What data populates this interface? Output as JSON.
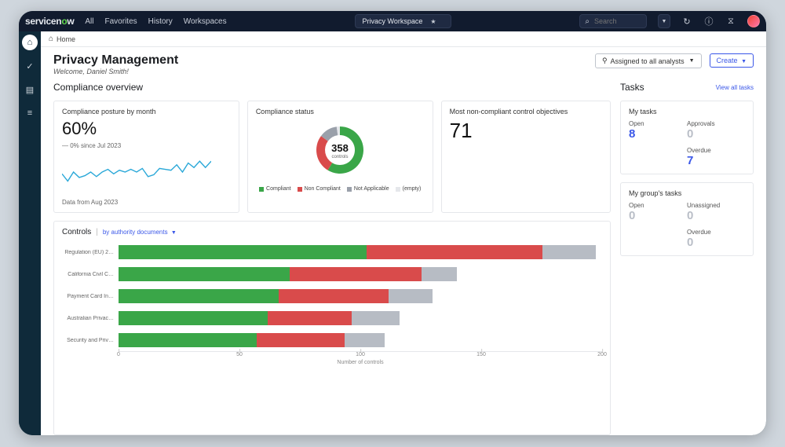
{
  "brand": {
    "prefix": "service",
    "mid": "n",
    "o": "o",
    "suffix": "w"
  },
  "nav": {
    "all": "All",
    "favorites": "Favorites",
    "history": "History",
    "workspaces": "Workspaces"
  },
  "workspace_pill": "Privacy Workspace",
  "search": {
    "placeholder": "Search"
  },
  "breadcrumb": {
    "home": "Home"
  },
  "page": {
    "title": "Privacy Management",
    "welcome": "Welcome, Daniel Smith!"
  },
  "buttons": {
    "assigned": "Assigned to all analysts",
    "create": "Create"
  },
  "overview_title": "Compliance overview",
  "posture": {
    "title": "Compliance posture by month",
    "value": "60%",
    "delta": "— 0%  since Jul 2023",
    "data_from": "Data from Aug 2023"
  },
  "status": {
    "title": "Compliance status",
    "center_value": "358",
    "center_label": "controls",
    "legend": [
      {
        "label": "Compliant",
        "color": "#3aa648"
      },
      {
        "label": "Non Compliant",
        "color": "#d94b4b"
      },
      {
        "label": "Not Applicable",
        "color": "#9aa0aa"
      },
      {
        "label": "(empty)",
        "color": "#e5e7eb"
      }
    ]
  },
  "noncompliant": {
    "title": "Most non-compliant control objectives",
    "value": "71"
  },
  "controls": {
    "title": "Controls",
    "by": "by authority documents",
    "axis_label": "Number of controls",
    "ticks": [
      "0",
      "50",
      "100",
      "150",
      "200"
    ]
  },
  "tasks_panel": {
    "title": "Tasks",
    "view_all": "View all tasks",
    "my": {
      "title": "My tasks",
      "open_label": "Open",
      "open": "8",
      "approvals_label": "Approvals",
      "approvals": "0",
      "overdue_label": "Overdue",
      "overdue": "7"
    },
    "group": {
      "title": "My group's tasks",
      "open_label": "Open",
      "open": "0",
      "unassigned_label": "Unassigned",
      "unassigned": "0",
      "overdue_label": "Overdue",
      "overdue": "0"
    }
  },
  "colors": {
    "green": "#3aa648",
    "red": "#d94b4b",
    "gray": "#b7bcc4"
  },
  "chart_data": [
    {
      "type": "line",
      "title": "Compliance posture by month",
      "ylim": [
        30,
        70
      ],
      "x": [
        0,
        1,
        2,
        3,
        4,
        5,
        6,
        7,
        8,
        9,
        10,
        11,
        12,
        13,
        14,
        15,
        16,
        17,
        18,
        19,
        20,
        21,
        22,
        23,
        24,
        25,
        26
      ],
      "values": [
        48,
        40,
        50,
        44,
        46,
        50,
        45,
        50,
        53,
        48,
        52,
        50,
        53,
        50,
        54,
        45,
        47,
        54,
        53,
        52,
        58,
        50,
        60,
        55,
        62,
        55,
        62
      ]
    },
    {
      "type": "pie",
      "title": "Compliance status",
      "total": 358,
      "series": [
        {
          "name": "Compliant",
          "value": 210,
          "color": "#3aa648"
        },
        {
          "name": "Non Compliant",
          "value": 95,
          "color": "#d94b4b"
        },
        {
          "name": "Not Applicable",
          "value": 45,
          "color": "#9aa0aa"
        },
        {
          "name": "(empty)",
          "value": 8,
          "color": "#e5e7eb"
        }
      ]
    },
    {
      "type": "bar",
      "orientation": "horizontal",
      "title": "Controls by authority documents",
      "xlabel": "Number of controls",
      "xlim": [
        0,
        220
      ],
      "categories": [
        "Regulation (EU) 2…",
        "California Civil C…",
        "Payment Card In…",
        "Australian Privac…",
        "Security and Priv…"
      ],
      "series": [
        {
          "name": "Compliant",
          "color": "#3aa648",
          "values": [
            113,
            78,
            73,
            68,
            63
          ]
        },
        {
          "name": "Non Compliant",
          "color": "#d94b4b",
          "values": [
            80,
            60,
            50,
            38,
            40
          ]
        },
        {
          "name": "Not Applicable",
          "color": "#b7bcc4",
          "values": [
            24,
            16,
            20,
            22,
            18
          ]
        }
      ]
    }
  ]
}
